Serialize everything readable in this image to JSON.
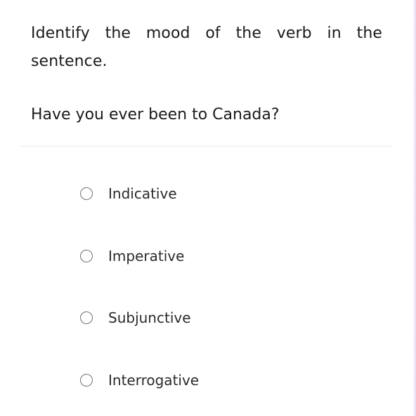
{
  "question": {
    "prompt": "Identify the mood of the verb in the sentence.",
    "sentence": "Have you ever been to Canada?"
  },
  "options": [
    {
      "label": "Indicative",
      "selected": false
    },
    {
      "label": "Imperative",
      "selected": false
    },
    {
      "label": "Subjunctive",
      "selected": false
    },
    {
      "label": "Interrogative",
      "selected": false
    }
  ]
}
